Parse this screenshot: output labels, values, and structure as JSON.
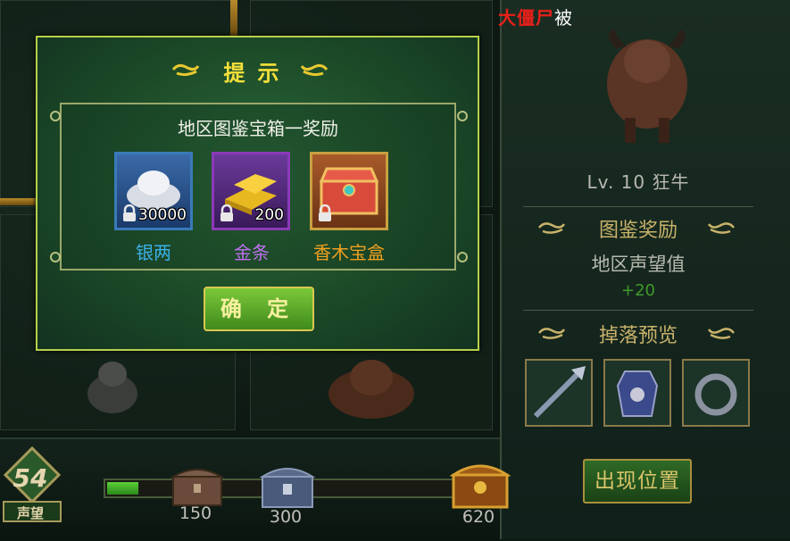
{
  "boss_label": {
    "name": "大僵尸",
    "tail": "被"
  },
  "monster": {
    "level_text": "Lv. 10  狂牛"
  },
  "rewards_panel": {
    "title": "图鉴奖励",
    "reputation_label": "地区声望值",
    "reputation_value": "+20",
    "drop_title": "掉落预览",
    "drops": [
      "spear-icon",
      "armor-icon",
      "ring-icon"
    ],
    "appear_button": "出现位置"
  },
  "reputation": {
    "level": "54",
    "caption": "声望",
    "progress": 0.08,
    "milestones": [
      "150",
      "300",
      "620"
    ]
  },
  "dialog": {
    "title": "提示",
    "reward_title": "地区图鉴宝箱一奖励",
    "items": [
      {
        "name": "银两",
        "count": "30000",
        "icon": "silver-ingot-icon",
        "border": "#3a7ab8",
        "name_color": "#3ab0e8"
      },
      {
        "name": "金条",
        "count": "200",
        "icon": "gold-bar-icon",
        "border": "#8a3ab8",
        "name_color": "#c070f0"
      },
      {
        "name": "香木宝盒",
        "count": "",
        "icon": "treasure-chest-icon",
        "border": "#c8a040",
        "name_color": "#f0a020"
      }
    ],
    "confirm_button": "确 定"
  }
}
